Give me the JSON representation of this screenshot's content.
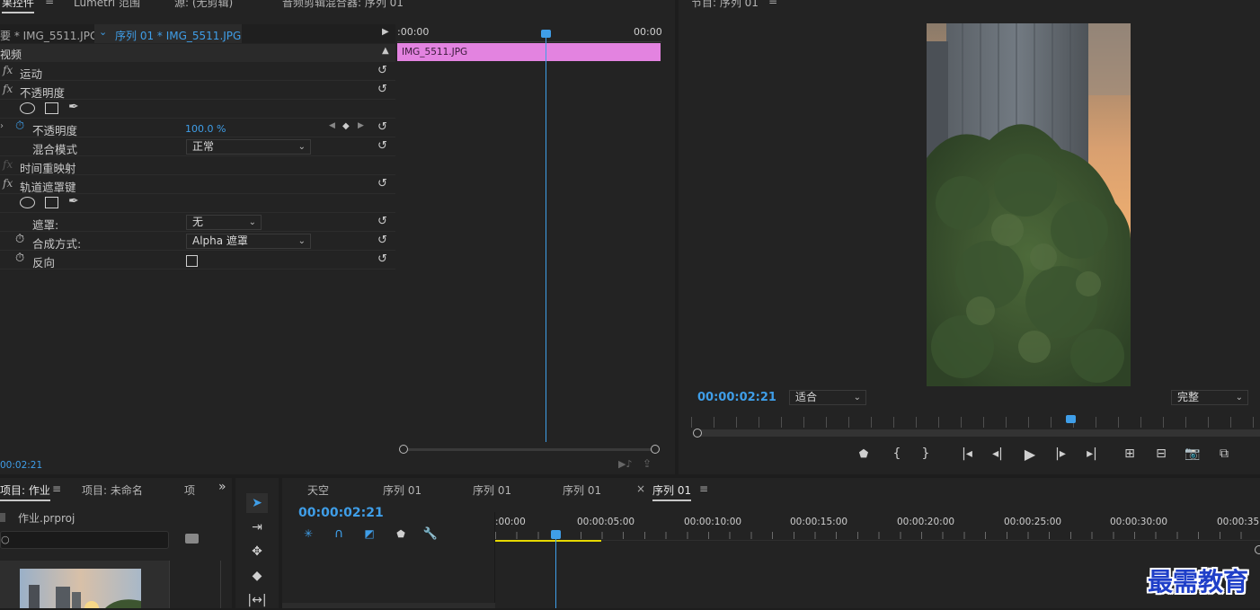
{
  "effect_controls": {
    "tabs": [
      "果控件",
      "Lumetri 范围",
      "源: (无剪辑)",
      "音频剪辑混合器: 序列 01"
    ],
    "source_clip": "要 * IMG_5511.JPG",
    "seq_clip": "序列 01 * IMG_5511.JPG",
    "time_start": ":00:00",
    "time_end": "00:00",
    "clip_bar_label": "IMG_5511.JPG",
    "section_video": "视频",
    "rows": {
      "motion": "运动",
      "opacity": "不透明度",
      "opacity_prop": "不透明度",
      "opacity_value": "100.0 %",
      "blend_mode": "混合模式",
      "blend_value": "正常",
      "time_remap": "时间重映射",
      "track_matte": "轨道遮罩键",
      "matte": "遮罩:",
      "matte_value": "无",
      "composite": "合成方式:",
      "composite_value": "Alpha 遮罩",
      "reverse": "反向"
    },
    "fx_label": "fx",
    "timecode": "00:02:21"
  },
  "program": {
    "title": "节目: 序列 01",
    "timecode": "00:00:02:21",
    "fit": "适合",
    "quality": "完整"
  },
  "project": {
    "tabs": [
      "项目: 作业",
      "项目: 未命名",
      "项"
    ],
    "more": "»",
    "file": "作业.prproj"
  },
  "timeline": {
    "tabs": [
      "天空",
      "序列 01",
      "序列 01",
      "序列 01",
      "序列 01"
    ],
    "close": "×",
    "timecode": "00:00:02:21",
    "ruler": [
      ":00:00",
      "00:00:05:00",
      "00:00:10:00",
      "00:00:15:00",
      "00:00:20:00",
      "00:00:25:00",
      "00:00:30:00",
      "00:00:35"
    ]
  },
  "watermark": "最需教育",
  "colors": {
    "accent": "#3f9ee8",
    "clip_pink": "#e383e0",
    "work_area": "#e6d800"
  }
}
